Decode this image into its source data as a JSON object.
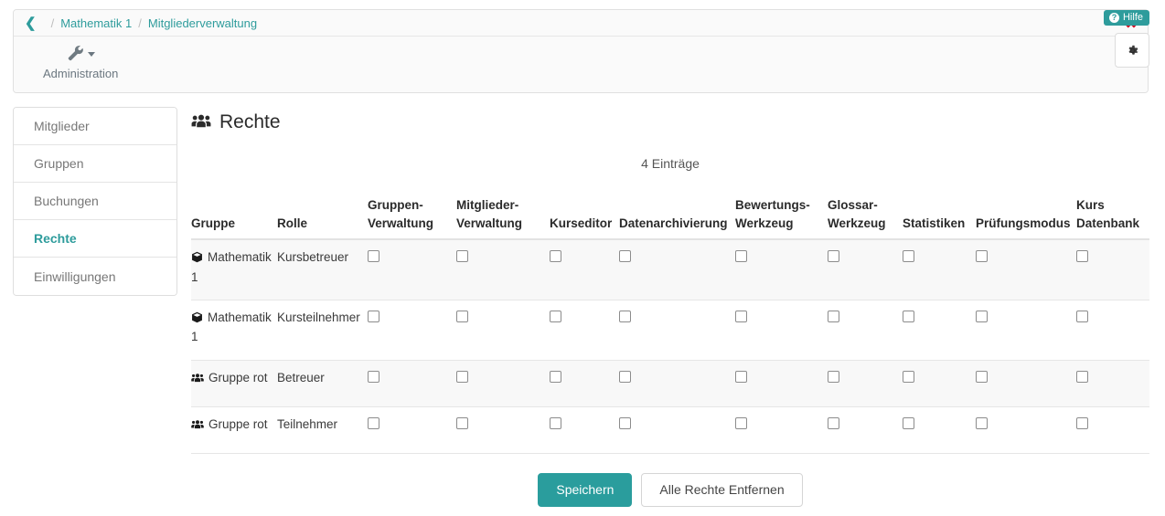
{
  "breadcrumb": {
    "back_icon": "chevron-left-icon",
    "separator": "/",
    "items": [
      "Mathematik 1",
      "Mitgliederverwaltung"
    ],
    "close_label": "✖"
  },
  "toolbar": {
    "items": [
      {
        "label": "Administration",
        "icon": "wrench-icon",
        "has_dropdown": true
      }
    ]
  },
  "sidebar": {
    "items": [
      {
        "label": "Mitglieder",
        "active": false
      },
      {
        "label": "Gruppen",
        "active": false
      },
      {
        "label": "Buchungen",
        "active": false
      },
      {
        "label": "Rechte",
        "active": true
      },
      {
        "label": "Einwilligungen",
        "active": false
      }
    ]
  },
  "main": {
    "title": "Rechte",
    "title_icon": "users-icon",
    "entries_count": "4 Einträge",
    "help_badge": {
      "label": "Hilfe",
      "icon": "question-circle-icon"
    },
    "settings_button": {
      "icon": "gear-icon"
    }
  },
  "table": {
    "columns": [
      "Gruppe",
      "Rolle",
      "Gruppen-Verwaltung",
      "Mitglieder-Verwaltung",
      "Kurseditor",
      "Datenarchivierung",
      "Bewertungs-Werkzeug",
      "Glossar-Werkzeug",
      "Statistiken",
      "Prüfungsmodus",
      "Kurs Datenbank"
    ],
    "columns_wrapped": [
      [
        "Gruppe"
      ],
      [
        "Rolle"
      ],
      [
        "Gruppen-",
        "Verwaltung"
      ],
      [
        "Mitglieder-",
        "Verwaltung"
      ],
      [
        "Kurseditor"
      ],
      [
        "Datenarchivierung"
      ],
      [
        "Bewertungs-",
        "Werkzeug"
      ],
      [
        "Glossar-",
        "Werkzeug"
      ],
      [
        "Statistiken"
      ],
      [
        "Prüfungsmodus"
      ],
      [
        "Kurs",
        "Datenbank"
      ]
    ],
    "rows": [
      {
        "gruppe": "Mathematik 1",
        "gruppe_icon": "cube-icon",
        "rolle": "Kursbetreuer",
        "striped": true,
        "permissions": [
          false,
          false,
          false,
          false,
          false,
          false,
          false,
          false,
          false
        ]
      },
      {
        "gruppe": "Mathematik 1",
        "gruppe_icon": "cube-icon",
        "rolle": "Kursteilnehmer",
        "striped": false,
        "permissions": [
          false,
          false,
          false,
          false,
          false,
          false,
          false,
          false,
          false
        ]
      },
      {
        "gruppe": "Gruppe rot",
        "gruppe_icon": "users-icon",
        "rolle": "Betreuer",
        "striped": true,
        "permissions": [
          false,
          false,
          false,
          false,
          false,
          false,
          false,
          false,
          false
        ]
      },
      {
        "gruppe": "Gruppe rot",
        "gruppe_icon": "users-icon",
        "rolle": "Teilnehmer",
        "striped": false,
        "permissions": [
          false,
          false,
          false,
          false,
          false,
          false,
          false,
          false,
          false
        ]
      }
    ]
  },
  "footer": {
    "save_label": "Speichern",
    "clear_label": "Alle Rechte Entfernen"
  },
  "colors": {
    "accent": "#2e9c9c",
    "primary_button": "#2a9d9d",
    "close_red": "#d0021b",
    "stripe": "#f8f8f8"
  }
}
